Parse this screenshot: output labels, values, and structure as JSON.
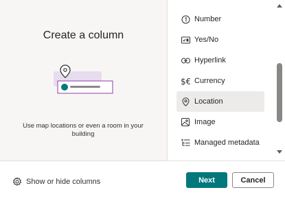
{
  "left": {
    "title": "Create a column",
    "description": "Use map locations or even a room in your building"
  },
  "column_types": [
    {
      "label": "Number",
      "icon": "number-circle-icon",
      "selected": false
    },
    {
      "label": "Yes/No",
      "icon": "toggle-icon",
      "selected": false
    },
    {
      "label": "Hyperlink",
      "icon": "link-icon",
      "selected": false
    },
    {
      "label": "Currency",
      "icon": "currency-icon",
      "selected": false
    },
    {
      "label": "Location",
      "icon": "location-pin-icon",
      "selected": true
    },
    {
      "label": "Image",
      "icon": "image-icon",
      "selected": false
    },
    {
      "label": "Managed metadata",
      "icon": "tree-icon",
      "selected": false
    }
  ],
  "footer": {
    "show_hide_label": "Show or hide columns",
    "next_label": "Next",
    "cancel_label": "Cancel"
  },
  "colors": {
    "accent": "#03787c",
    "selected_bg": "#edebe9",
    "pane_bg": "#f8f6f4"
  }
}
